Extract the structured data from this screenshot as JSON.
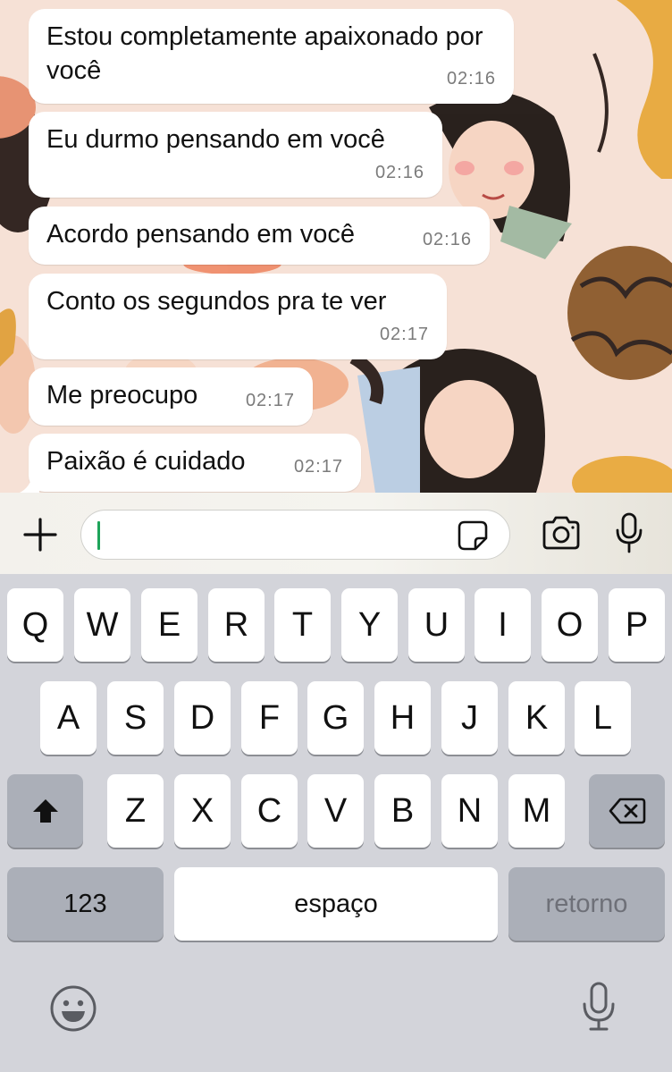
{
  "messages": [
    {
      "text": "Estou completamente apaixonado por você",
      "time": "02:16"
    },
    {
      "text": "Eu durmo pensando em você",
      "time": "02:16"
    },
    {
      "text": "Acordo pensando em você",
      "time": "02:16"
    },
    {
      "text": "Conto os segundos pra te ver",
      "time": "02:17"
    },
    {
      "text": "Me preocupo",
      "time": "02:17"
    },
    {
      "text": "Paixão é cuidado",
      "time": "02:17"
    }
  ],
  "composer": {
    "value": "",
    "icons": {
      "add": "plus-icon",
      "sticker": "sticker-icon",
      "camera": "camera-icon",
      "mic": "microphone-icon"
    },
    "caret_color": "#1ea45a"
  },
  "keyboard": {
    "row1": [
      "Q",
      "W",
      "E",
      "R",
      "T",
      "Y",
      "U",
      "I",
      "O",
      "P"
    ],
    "row2": [
      "A",
      "S",
      "D",
      "F",
      "G",
      "H",
      "J",
      "K",
      "L"
    ],
    "row3": [
      "Z",
      "X",
      "C",
      "V",
      "B",
      "N",
      "M"
    ],
    "numbers_key": "123",
    "space_key": "espaço",
    "return_key": "retorno",
    "icons": {
      "shift": "shift-icon",
      "backspace": "backspace-icon",
      "emoji": "emoji-icon",
      "dictation": "dictation-mic-icon"
    }
  }
}
